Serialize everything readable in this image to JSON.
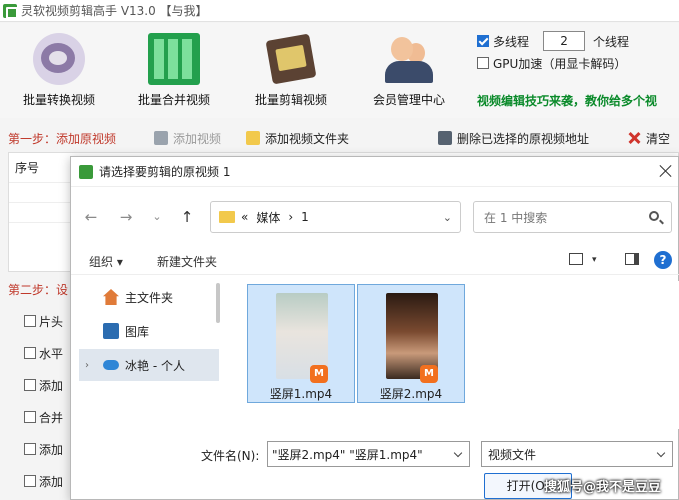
{
  "app": {
    "title": "灵软视频剪辑高手 V13.0 【与我】",
    "tools": [
      {
        "label": "批量转换视频",
        "icon": "convert-icon"
      },
      {
        "label": "批量合并视频",
        "icon": "merge-icon"
      },
      {
        "label": "批量剪辑视频",
        "icon": "cut-icon"
      },
      {
        "label": "会员管理中心",
        "icon": "member-icon"
      }
    ],
    "options": {
      "multithread_label": "多线程",
      "multithread_checked": true,
      "thread_count": "2",
      "thread_unit": "个线程",
      "gpu_label": "GPU加速（用显卡解码）",
      "gpu_checked": false
    },
    "tips": "视频编辑技巧来袭，教你给多个视",
    "step1": {
      "label": "第一步：添加原视频",
      "add_video": "添加视频",
      "add_folder": "添加视频文件夹",
      "delete_selected": "删除已选择的原视频地址",
      "clear": "清空"
    },
    "list": {
      "col_index": "序号"
    },
    "step2": {
      "label": "第二步：设",
      "items": [
        "片头",
        "水平",
        "添加",
        "合并",
        "添加",
        "添加"
      ]
    }
  },
  "dialog": {
    "title": "请选择要剪辑的原视频 1",
    "breadcrumb": [
      "«",
      "媒体",
      "›",
      "1"
    ],
    "search_placeholder": "在 1 中搜索",
    "organize": "组织 ▾",
    "new_folder": "新建文件夹",
    "help": "?",
    "nav_items": [
      {
        "label": "主文件夹",
        "icon": "home-icon"
      },
      {
        "label": "图库",
        "icon": "gallery-icon"
      },
      {
        "label": "冰艳 - 个人",
        "icon": "onedrive-icon"
      }
    ],
    "files": [
      {
        "name": "竖屏1.mp4",
        "badge": "M"
      },
      {
        "name": "竖屏2.mp4",
        "badge": "M"
      }
    ],
    "filename_label": "文件名(N):",
    "filename_value": "\"竖屏2.mp4\" \"竖屏1.mp4\"",
    "filetype": "视频文件",
    "open_button": "打开(O)"
  },
  "watermark": "搜狐号@我不是豆豆"
}
